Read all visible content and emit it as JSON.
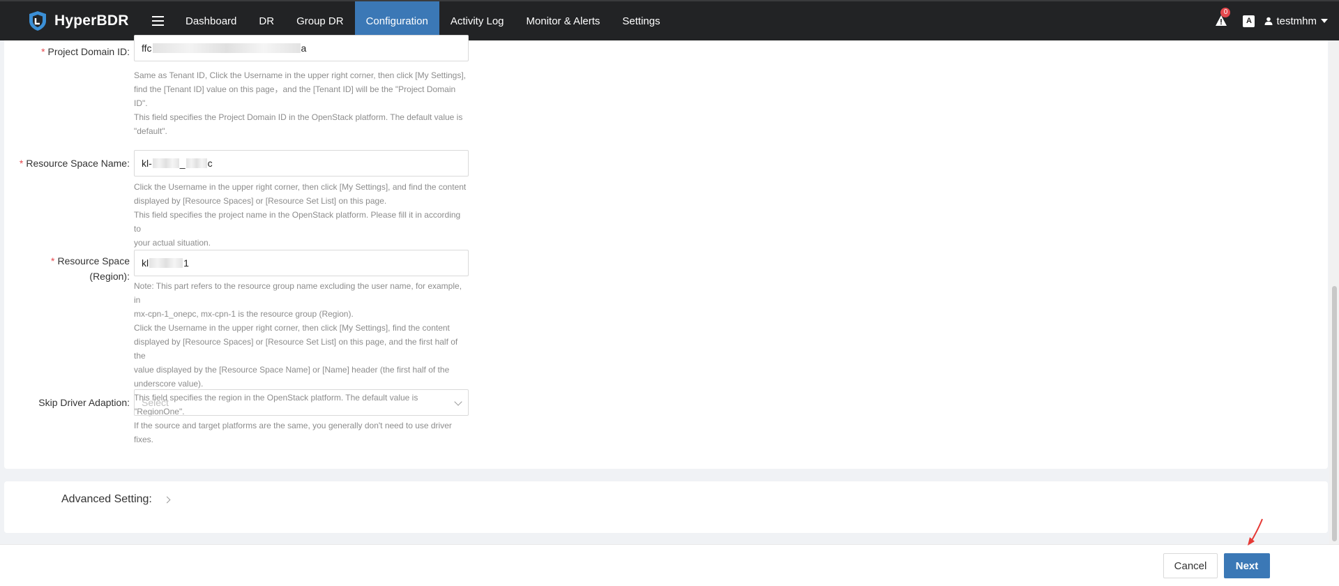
{
  "app": {
    "name": "HyperBDR"
  },
  "nav": {
    "items": [
      {
        "label": "Dashboard"
      },
      {
        "label": "DR"
      },
      {
        "label": "Group DR"
      },
      {
        "label": "Configuration"
      },
      {
        "label": "Activity Log"
      },
      {
        "label": "Monitor & Alerts"
      },
      {
        "label": "Settings"
      }
    ],
    "active": "Configuration"
  },
  "header": {
    "alert_count": "0",
    "lang_icon": "A",
    "username": "testmhm"
  },
  "form": {
    "project_domain_id": {
      "label": "Project Domain ID:",
      "required_mark": "*",
      "value_start": "ffc",
      "value_end": "a",
      "help": [
        "Same as Tenant ID, Click the Username in the upper right corner, then click [My Settings],",
        "find the [Tenant ID] value on this page，and the [Tenant ID] will be the \"Project Domain",
        "ID\".",
        "This field specifies the Project Domain ID in the OpenStack platform. The default value is",
        "\"default\"."
      ]
    },
    "resource_space_name": {
      "label": "Resource Space Name:",
      "required_mark": "*",
      "value_start": "kl-",
      "value_mid": "_",
      "value_end": "c",
      "help": [
        "Click the Username in the upper right corner, then click [My Settings], and find the content",
        "displayed by [Resource Spaces] or [Resource Set List] on this page.",
        "This field specifies the project name in the OpenStack platform. Please fill it in according to",
        "your actual situation."
      ]
    },
    "resource_space_region": {
      "label_line1": "Resource Space",
      "label_line2": "(Region):",
      "required_mark": "*",
      "value_start": "kl",
      "value_end": "1",
      "help": [
        "Note: This part refers to the resource group name excluding the user name, for example, in",
        "mx-cpn-1_onepc, mx-cpn-1 is the resource group (Region).",
        "Click the Username in the upper right corner, then click [My Settings], find the content",
        "displayed by [Resource Spaces] or [Resource Set List] on this page, and the first half of the",
        "value displayed by the [Resource Space Name] or [Name] header (the first half of the",
        "underscore value).",
        "This field specifies the region in the OpenStack platform. The default value is \"RegionOne\"."
      ]
    },
    "skip_driver_adaption": {
      "label": "Skip Driver Adaption:",
      "placeholder": "Select",
      "help": [
        "If the source and target platforms are the same, you generally don't need to use driver",
        "fixes."
      ]
    }
  },
  "advanced": {
    "label": "Advanced Setting:"
  },
  "footer": {
    "cancel_label": "Cancel",
    "next_label": "Next"
  },
  "colors": {
    "accent": "#3b78b6",
    "topbar": "#222325",
    "required": "#e5484d",
    "arrow": "#e53935"
  }
}
